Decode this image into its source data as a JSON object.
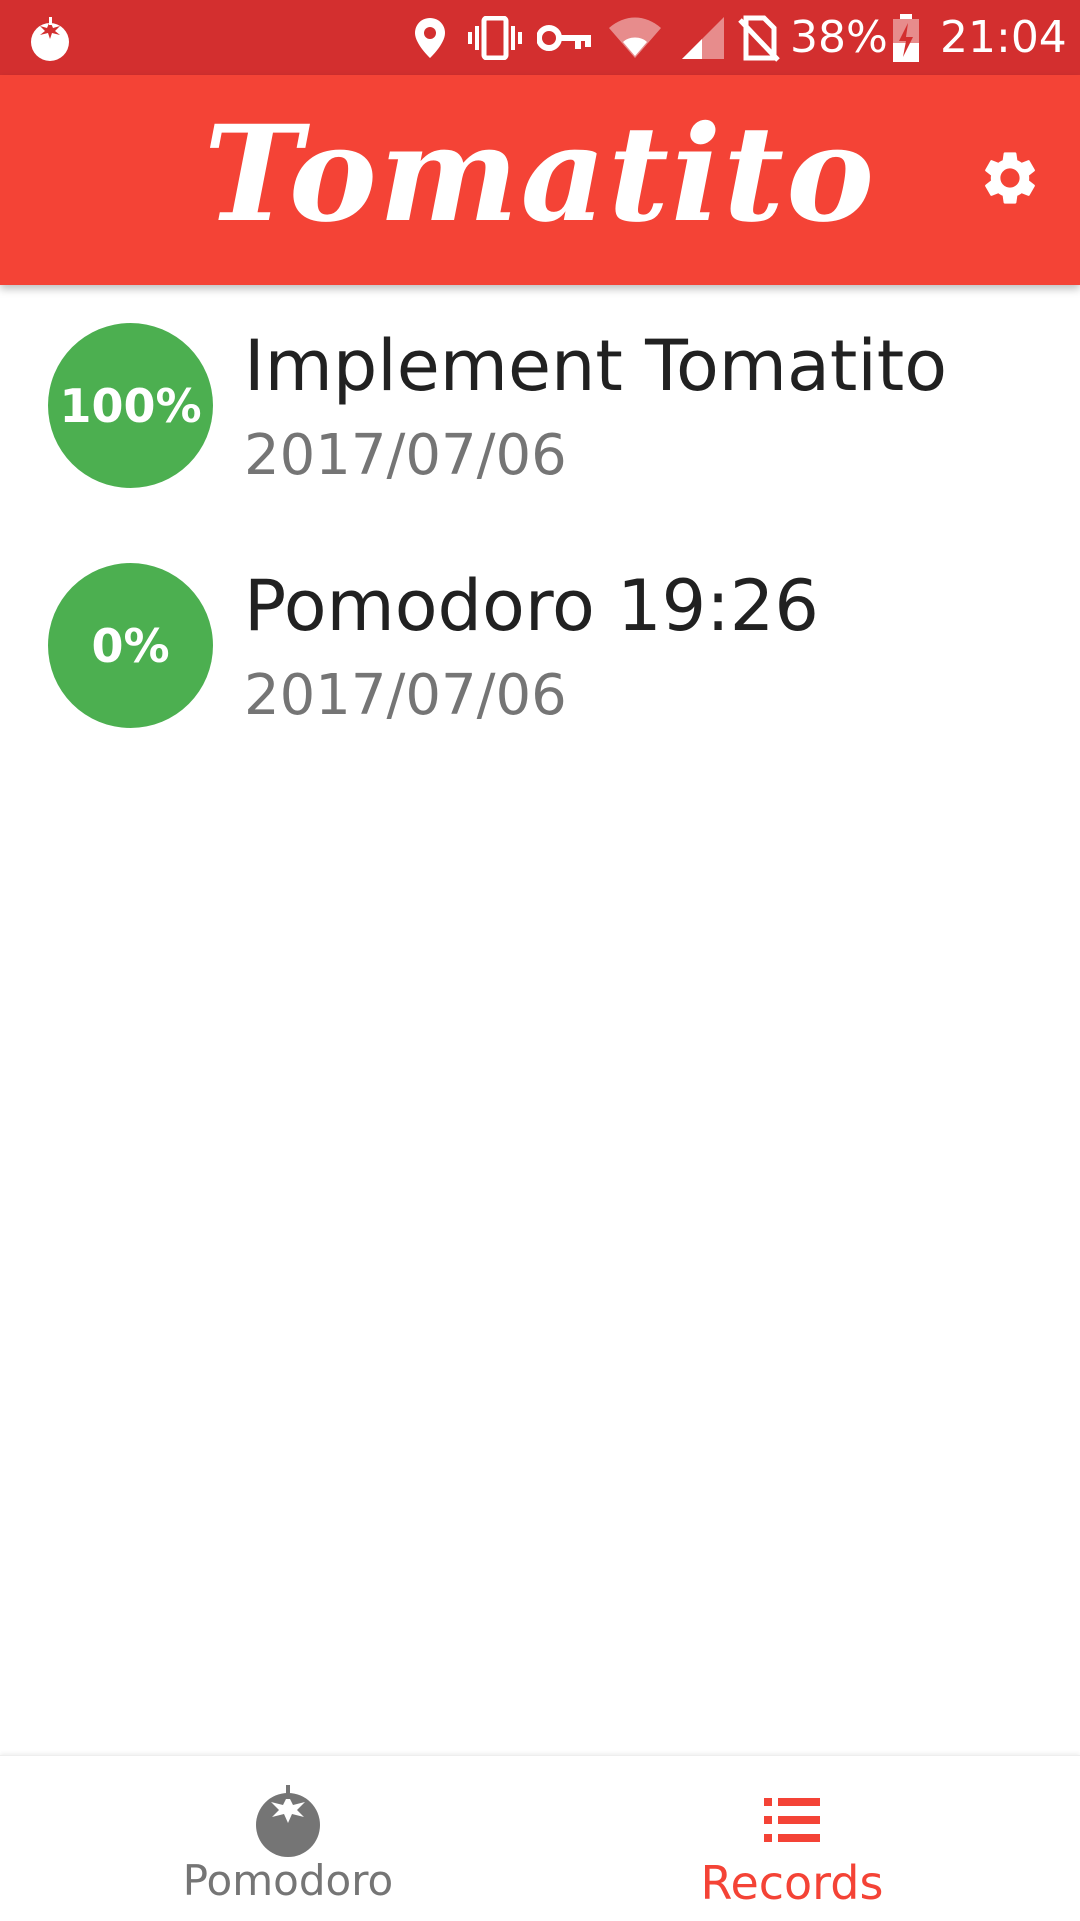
{
  "status_bar": {
    "battery": "38%",
    "time": "21:04",
    "icons": [
      "tomato-icon",
      "location-icon",
      "vibrate-icon",
      "vpn-key-icon",
      "wifi-icon",
      "signal-icon",
      "no-sim-icon",
      "battery-charging-icon"
    ]
  },
  "app_bar": {
    "title": "Tomatito",
    "settings_icon": "gear-icon"
  },
  "records": [
    {
      "progress": "100%",
      "title": "Implement Tomatito",
      "date": "2017/07/06"
    },
    {
      "progress": "0%",
      "title": "Pomodoro 19:26",
      "date": "2017/07/06"
    }
  ],
  "bottom_nav": {
    "items": [
      {
        "label": "Pomodoro",
        "icon": "tomato-icon",
        "active": false
      },
      {
        "label": "Records",
        "icon": "list-icon",
        "active": true
      }
    ]
  },
  "colors": {
    "status_bar": "#d32f2f",
    "app_bar": "#f44336",
    "progress": "#4caf50",
    "nav_active": "#f44336",
    "nav_inactive": "#757575"
  }
}
